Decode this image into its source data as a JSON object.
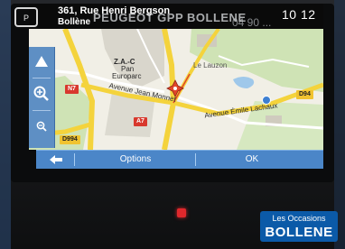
{
  "topbar": {
    "brand_logo_text": "P",
    "address_line1": "361, Rue Henri Bergson",
    "address_line2": "Bollène",
    "dealer_name": "PEUGEOT GPP BOLLENE",
    "phone": "04 90 ...",
    "clock": "10 12"
  },
  "map": {
    "labels": {
      "za": "Z.A.-C",
      "pan": "Pan",
      "europarc": "Europarc",
      "lauzon": "Le Lauzon",
      "avenue_jean_monnet": "Avenue Jean Monnet",
      "avenue_emile_lachaux": "Avenue Émile Lachaux"
    },
    "shields": {
      "n7": "N7",
      "a7": "A7",
      "d994_right": "D94",
      "d994_left": "D994"
    },
    "colors": {
      "land": "#f1efe6",
      "green_area": "#cfe3b5",
      "industrial": "#d9d6cc",
      "road_yellow": "#f4d33c",
      "road_white": "#ffffff",
      "water": "#9fc8ea",
      "shield_red": "#d8382d"
    }
  },
  "leftpanel": {
    "up_icon": "triangle-up-icon",
    "zoom_in_icon": "zoom-in-icon",
    "zoom_out_icon": "zoom-out-icon"
  },
  "bottombar": {
    "back_icon": "arrow-left-icon",
    "options_label": "Options",
    "ok_label": "OK"
  },
  "badge": {
    "top": "Les Occasions",
    "main": "BOLLENE"
  }
}
